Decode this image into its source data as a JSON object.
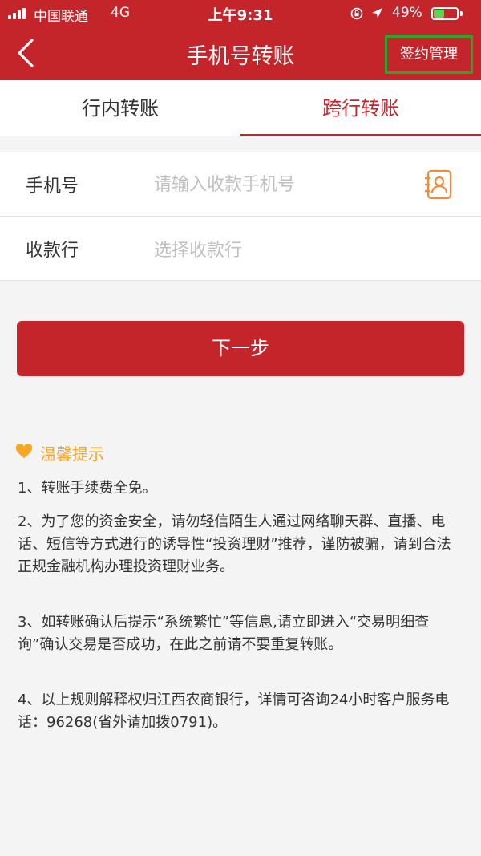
{
  "status_bar": {
    "carrier": "中国联通",
    "network": "4G",
    "time": "上午9:31",
    "battery_percent": "49%",
    "battery_level": 0.49,
    "battery_color": "#58d654",
    "icons": [
      "signal-bars-icon",
      "orientation-lock-icon",
      "location-arrow-icon",
      "battery-icon"
    ]
  },
  "nav": {
    "back_icon": "chevron-left-icon",
    "title": "手机号转账",
    "sign_management": "签约管理",
    "bar_color": "#c4252a",
    "highlight_border_color": "#2aa62a"
  },
  "tabs": [
    {
      "label": "行内转账",
      "active": false
    },
    {
      "label": "跨行转账",
      "active": true
    }
  ],
  "form": {
    "phone": {
      "label": "手机号",
      "placeholder": "请输入收款手机号",
      "value": "",
      "icon": "contact-book-icon"
    },
    "bank": {
      "label": "收款行",
      "placeholder": "选择收款行",
      "value": ""
    }
  },
  "next_button": {
    "label": "下一步"
  },
  "tips": {
    "icon": "heart-icon",
    "title": "温馨提示",
    "title_color": "#f5a623",
    "items": [
      "1、转账手续费全免。",
      "2、为了您的资金安全，请勿轻信陌生人通过网络聊天群、直播、电话、短信等方式进行的诱导性“投资理财”推荐，谨防被骗，请到合法正规金融机构办理投资理财业务。",
      "3、如转账确认后提示“系统繁忙”等信息,请立即进入“交易明细查询”确认交易是否成功，在此之前请不要重复转账。",
      "4、以上规则解释权归江西农商银行，详情可咨询24小时客户服务电话：96268(省外请加拨0791)。"
    ]
  }
}
